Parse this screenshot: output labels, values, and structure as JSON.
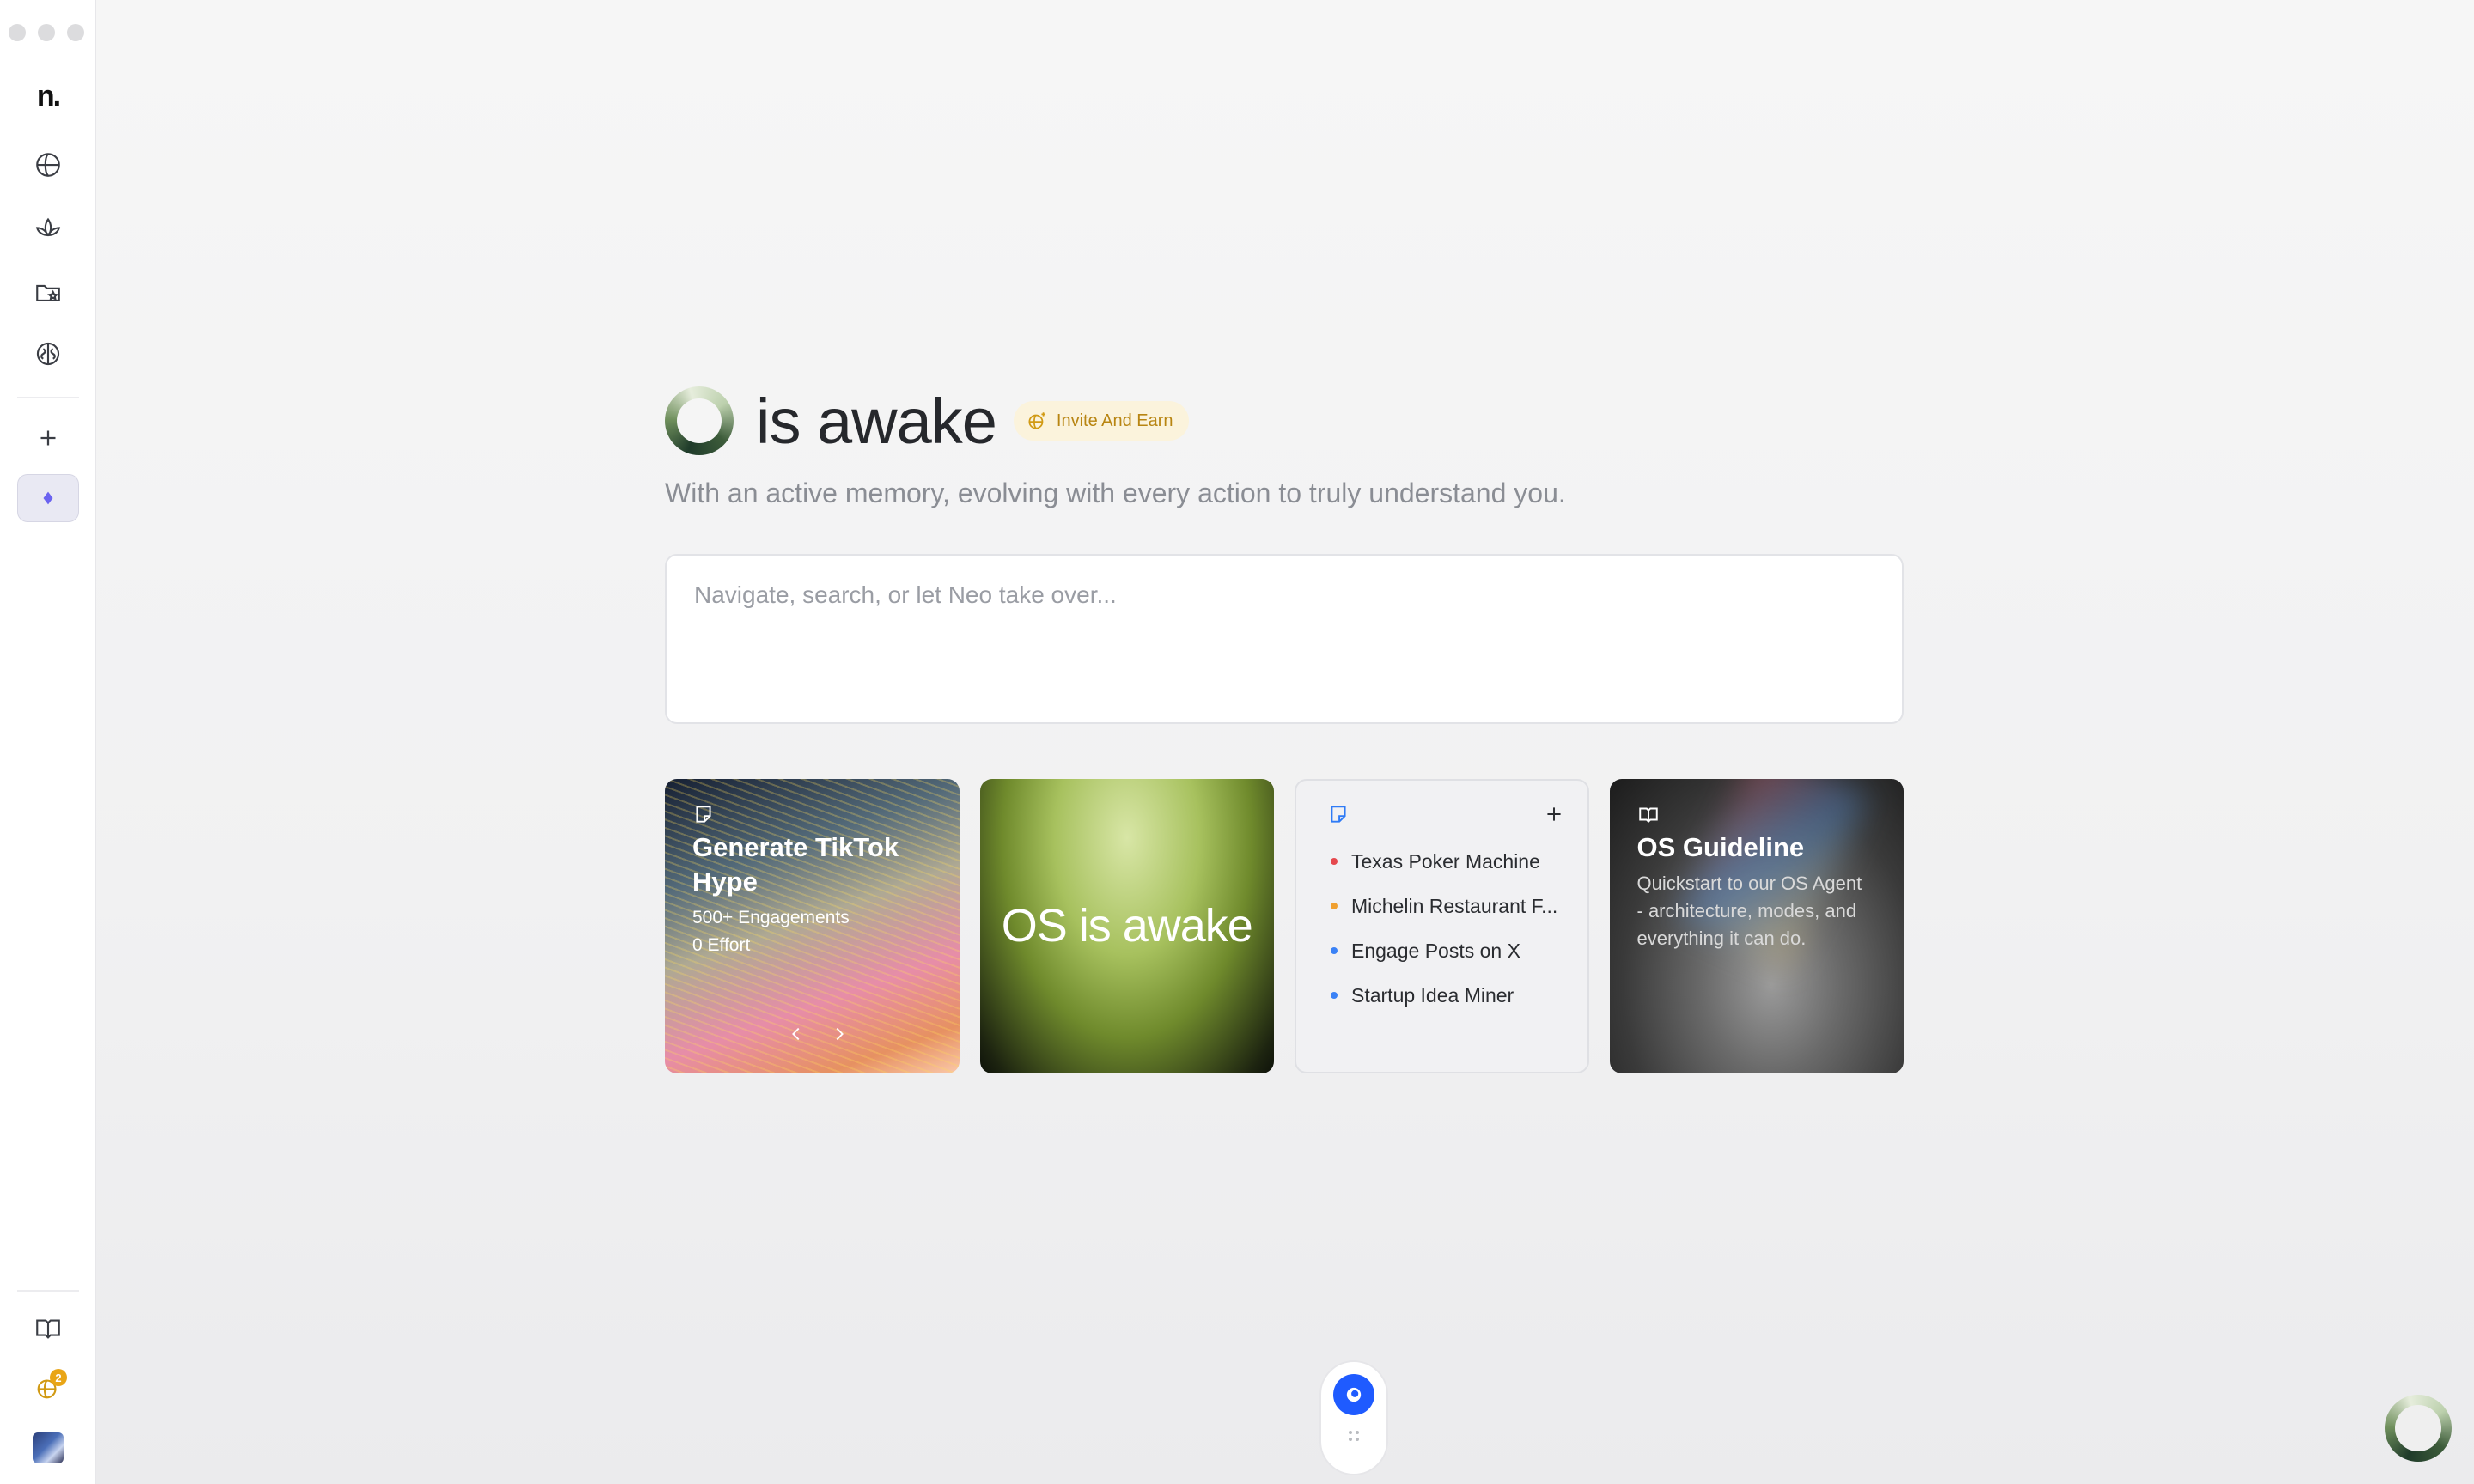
{
  "sidebar": {
    "logo": "n.",
    "items": [
      {
        "icon": "globe-icon"
      },
      {
        "icon": "lotus-icon"
      },
      {
        "icon": "folder-star-icon"
      },
      {
        "icon": "brain-icon"
      },
      {
        "icon": "plus-icon"
      },
      {
        "icon": "diamond-icon"
      }
    ],
    "bottom": [
      {
        "icon": "book-icon"
      },
      {
        "icon": "globe-sparkle-icon",
        "badge": "2"
      },
      {
        "icon": "avatar"
      }
    ]
  },
  "hero": {
    "title": "is awake",
    "invite_label": "Invite And Earn",
    "subtitle": "With an active memory, evolving with every action to truly understand you."
  },
  "search": {
    "placeholder": "Navigate, search, or let Neo take over...",
    "value": ""
  },
  "cards": {
    "tiktok": {
      "title": "Generate TikTok Hype",
      "line1": "500+ Engagements",
      "line2": "0 Effort"
    },
    "awake": {
      "text": "OS is awake"
    },
    "list": {
      "items": [
        {
          "label": "Texas Poker Machine",
          "color": "#e5484d"
        },
        {
          "label": "Michelin Restaurant F...",
          "color": "#f0a030"
        },
        {
          "label": "Engage Posts on X",
          "color": "#3b82f6"
        },
        {
          "label": "Startup Idea Miner",
          "color": "#3b82f6"
        }
      ]
    },
    "guide": {
      "title": "OS Guideline",
      "description": "Quickstart to our OS Agent - architecture, modes, and everything it can do."
    }
  },
  "colors": {
    "accent": "#1f5bff",
    "invite_bg": "#fbf3dc",
    "invite_text": "#b88512",
    "active_nav": "#6b63f0"
  }
}
